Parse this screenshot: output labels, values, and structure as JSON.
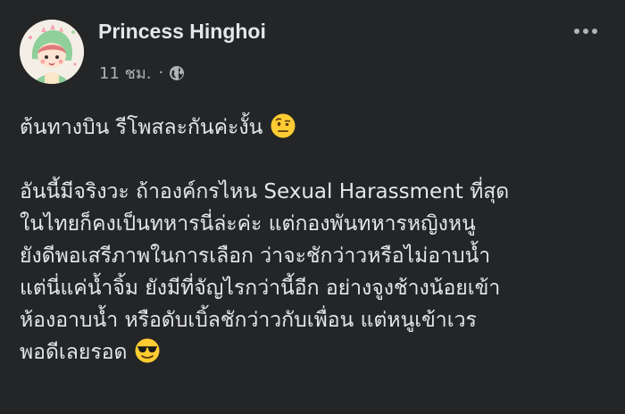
{
  "post": {
    "author": "Princess Hinghoi",
    "time": "11 ชม.",
    "separator": "·",
    "privacy_icon": "globe-icon",
    "more_icon": "more-options-icon",
    "paragraph1": [
      "ต้นทางบิน รีโพสละกันค่ะงั้น"
    ],
    "paragraph2": [
      "อันนี้มีจริงวะ ถ้าองค์กรไหน Sexual Harassment ที่สุด",
      "ในไทยก็คงเป็นทหารนี่ล่ะค่ะ แต่กองพันทหารหญิงหนู",
      "ยังดีพอเสรีภาพในการเลือก ว่าจะชักว่าวหรือไม่อาบน้ำ",
      "แต่นี่แค่น้ำจิ้ม ยังมีที่จัญไรกว่านี้อีก อย่างจูงช้างน้อยเข้า",
      "ห้องอาบน้ำ หรือดับเบิ้ลชักว่าวกับเพื่อน แต่หนูเข้าเวร",
      "พอดีเลยรอด"
    ],
    "emoji1": "face-with-raised-eyebrow-emoji",
    "emoji2": "sunglasses-emoji"
  },
  "colors": {
    "background": "#242526",
    "primary_text": "#e4e6eb",
    "secondary_text": "#b0b3b8",
    "emoji_yellow": "#ffcc33"
  }
}
